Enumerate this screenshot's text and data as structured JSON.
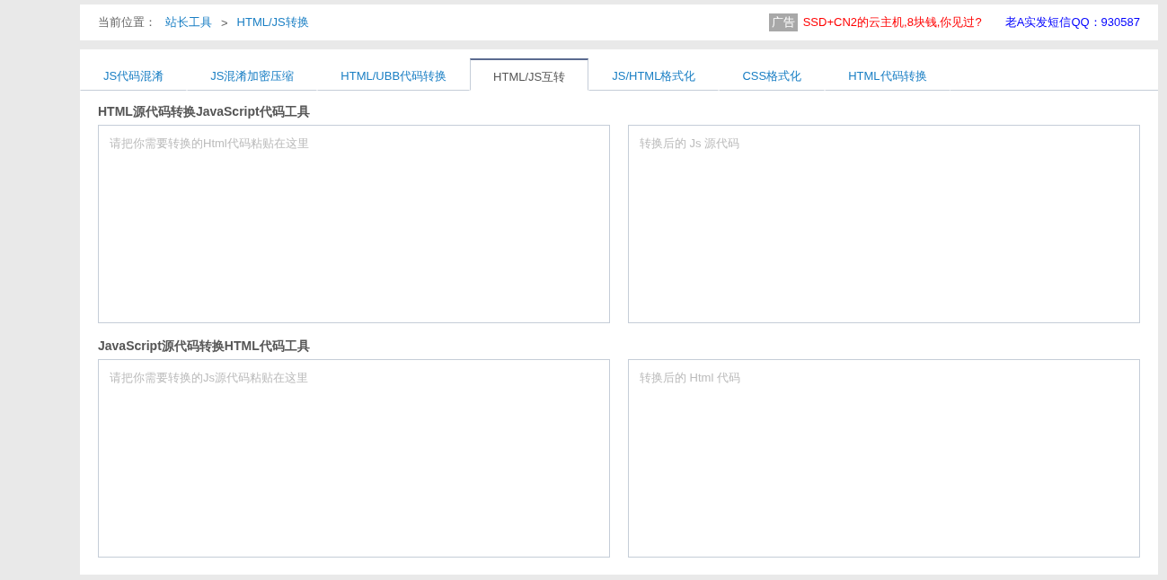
{
  "breadcrumb": {
    "label": "当前位置：",
    "items": [
      "站长工具",
      "HTML/JS转换"
    ],
    "separator": ">"
  },
  "ad": {
    "badge": "广告",
    "text": "SSD+CN2的云主机,8块钱,你见过?"
  },
  "contact": "老A实发短信QQ：930587",
  "tabs": [
    {
      "label": "JS代码混淆",
      "selected": false
    },
    {
      "label": "JS混淆加密压缩",
      "selected": false
    },
    {
      "label": "HTML/UBB代码转换",
      "selected": false
    },
    {
      "label": "HTML/JS互转",
      "selected": true
    },
    {
      "label": "JS/HTML格式化",
      "selected": false
    },
    {
      "label": "CSS格式化",
      "selected": false
    },
    {
      "label": "HTML代码转换",
      "selected": false
    }
  ],
  "sections": [
    {
      "title": "HTML源代码转换JavaScript代码工具",
      "input": {
        "placeholder": "请把你需要转换的Html代码粘贴在这里"
      },
      "output": {
        "placeholder": "转换后的 Js 源代码"
      }
    },
    {
      "title": "JavaScript源代码转换HTML代码工具",
      "input": {
        "placeholder": "请把你需要转换的Js源代码粘贴在这里"
      },
      "output": {
        "placeholder": "转换后的 Html 代码"
      }
    }
  ]
}
